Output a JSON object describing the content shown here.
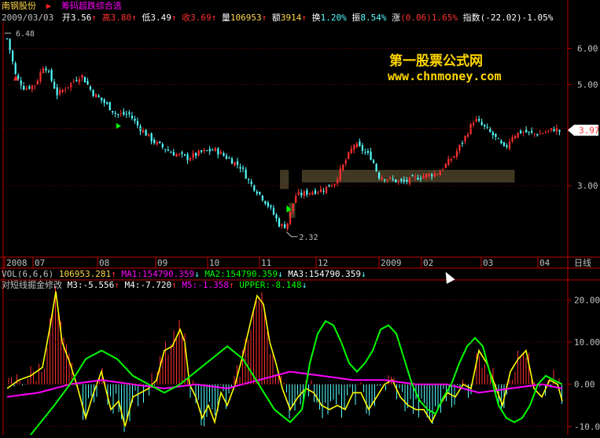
{
  "stock": {
    "name": "南钢股份",
    "flag": "▶",
    "formula": "筹码超跌综合选"
  },
  "quote": {
    "date": "2009/03/03",
    "open_label": "开",
    "open": "3.56",
    "high_label": "高",
    "high": "3.80",
    "low_label": "低",
    "low": "3.49",
    "close_label": "收",
    "close": "3.69",
    "vol_label": "量",
    "vol": "106953",
    "amt_label": "额",
    "amt": "3914",
    "turn_label": "换",
    "turn": "1.20%",
    "amp_label": "振",
    "amp": "8.54%",
    "chg_label": "涨",
    "chg": "(0.06)",
    "chg_pct": "1.65%",
    "idx_label": "指数",
    "idx": "(-22.02)",
    "idx_pct": "-1.05%",
    "up_arrow": "↑"
  },
  "watermark": {
    "title": "第一股票公式网",
    "url": "www.chnmoney.com"
  },
  "main_labels": {
    "high_mark": "6.48",
    "low_mark": "2.32",
    "last_price": "3.97"
  },
  "time_axis": {
    "labels": [
      "2008",
      "07",
      "08",
      "09",
      "10",
      "11",
      "12",
      "2009",
      "02",
      "03",
      "04"
    ],
    "period": "日线"
  },
  "vol_line": {
    "name": "VOL(6,6,6)",
    "value": "106953.281",
    "ma1": "MA1:154790.359",
    "ma2": "MA2:154790.359",
    "ma3": "MA3:154790.359",
    "up": "↑",
    "down": "↓"
  },
  "ind_line": {
    "name": "对短线掘金修改",
    "m3": "M3:-5.556",
    "m4": "M4:-7.720",
    "m5": "M5:-1.358",
    "upper": "UPPER:-8.148"
  },
  "colors": {
    "up": "#ff3030",
    "down": "#54ffff",
    "grid": "#8b0000",
    "axis": "#c00000",
    "m3": "#ffff00",
    "m5": "#ff00ff",
    "upper": "#00ff00",
    "zone": "#b8a060"
  },
  "chart_data": [
    {
      "type": "candlestick",
      "title": "南钢股份",
      "yticks": [
        3.0,
        4.0,
        5.0,
        6.0
      ],
      "ylim": [
        2.1,
        6.8
      ],
      "y_scale": "log",
      "annotations": {
        "high": 6.48,
        "low": 2.32,
        "last": 3.97
      },
      "close_path": [
        [
          0,
          6.3
        ],
        [
          8,
          5.2
        ],
        [
          16,
          4.9
        ],
        [
          26,
          5.0
        ],
        [
          34,
          5.55
        ],
        [
          46,
          4.75
        ],
        [
          55,
          4.95
        ],
        [
          68,
          5.25
        ],
        [
          78,
          4.8
        ],
        [
          92,
          4.5
        ],
        [
          100,
          4.3
        ],
        [
          112,
          4.3
        ],
        [
          120,
          4.05
        ],
        [
          134,
          3.75
        ],
        [
          150,
          3.55
        ],
        [
          165,
          3.45
        ],
        [
          178,
          3.55
        ],
        [
          190,
          3.6
        ],
        [
          202,
          3.45
        ],
        [
          214,
          3.3
        ],
        [
          222,
          3.05
        ],
        [
          230,
          2.9
        ],
        [
          240,
          2.7
        ],
        [
          250,
          2.45
        ],
        [
          256,
          2.45
        ],
        [
          264,
          2.85
        ],
        [
          276,
          2.9
        ],
        [
          290,
          2.95
        ],
        [
          300,
          3.05
        ],
        [
          310,
          3.4
        ],
        [
          318,
          3.7
        ],
        [
          325,
          3.6
        ],
        [
          334,
          3.45
        ],
        [
          340,
          3.15
        ],
        [
          350,
          3.1
        ],
        [
          362,
          3.05
        ],
        [
          380,
          3.15
        ],
        [
          395,
          3.2
        ],
        [
          410,
          3.5
        ],
        [
          420,
          3.85
        ],
        [
          428,
          4.2
        ],
        [
          436,
          4.05
        ],
        [
          446,
          3.85
        ],
        [
          456,
          3.6
        ],
        [
          462,
          3.85
        ],
        [
          472,
          3.95
        ],
        [
          480,
          3.9
        ],
        [
          488,
          3.9
        ],
        [
          496,
          3.95
        ],
        [
          502,
          4.0
        ],
        [
          506,
          3.95
        ]
      ]
    },
    {
      "type": "histogram",
      "title": "VOL(6,6,6)",
      "values_note": "volume sub-panel",
      "series": [
        {
          "name": "VOL",
          "last": 106953.281
        },
        {
          "name": "MA1",
          "last": 154790.359
        }
      ]
    },
    {
      "type": "line",
      "title": "对短线掘金修改",
      "yticks": [
        -10.0,
        0.0,
        10.0,
        20.0
      ],
      "ylim": [
        -12,
        24
      ],
      "series": [
        {
          "name": "M3",
          "last": -5.556,
          "points": [
            [
              0,
              -1
            ],
            [
              15,
              1
            ],
            [
              30,
              2
            ],
            [
              45,
              4
            ],
            [
              55,
              14
            ],
            [
              62,
              22
            ],
            [
              70,
              10
            ],
            [
              80,
              5
            ],
            [
              90,
              -1
            ],
            [
              100,
              -8
            ],
            [
              110,
              -2
            ],
            [
              120,
              3
            ],
            [
              132,
              -6
            ],
            [
              142,
              -4
            ],
            [
              150,
              -10
            ],
            [
              160,
              -3
            ],
            [
              170,
              -2
            ],
            [
              180,
              -1
            ],
            [
              190,
              1
            ],
            [
              200,
              8
            ],
            [
              210,
              9
            ],
            [
              220,
              13
            ],
            [
              226,
              10
            ],
            [
              232,
              0
            ],
            [
              240,
              -3
            ],
            [
              248,
              -8
            ],
            [
              256,
              -5
            ],
            [
              264,
              -9
            ],
            [
              272,
              -2
            ],
            [
              280,
              -5
            ],
            [
              290,
              0
            ],
            [
              300,
              7
            ],
            [
              310,
              15
            ],
            [
              318,
              21
            ],
            [
              326,
              19
            ],
            [
              334,
              10
            ],
            [
              342,
              5
            ],
            [
              350,
              -1
            ],
            [
              360,
              -6
            ],
            [
              370,
              -3
            ],
            [
              380,
              -1
            ],
            [
              390,
              -2
            ],
            [
              400,
              -5
            ],
            [
              410,
              -6
            ],
            [
              420,
              -5
            ],
            [
              430,
              -6
            ],
            [
              440,
              -2
            ],
            [
              450,
              -2
            ],
            [
              460,
              -6
            ],
            [
              470,
              -3
            ],
            [
              480,
              0
            ],
            [
              490,
              1
            ],
            [
              500,
              -3
            ],
            [
              510,
              -5
            ],
            [
              520,
              -6
            ],
            [
              530,
              -6
            ],
            [
              540,
              -9
            ],
            [
              550,
              -5
            ],
            [
              560,
              -2
            ],
            [
              570,
              -3
            ],
            [
              580,
              0
            ],
            [
              590,
              -1
            ],
            [
              600,
              8
            ],
            [
              610,
              5
            ],
            [
              620,
              0
            ],
            [
              630,
              -5
            ],
            [
              640,
              3
            ],
            [
              650,
              6
            ],
            [
              660,
              8
            ],
            [
              670,
              -1
            ],
            [
              680,
              -3
            ],
            [
              690,
              1
            ],
            [
              700,
              0
            ],
            [
              706,
              -4
            ]
          ]
        },
        {
          "name": "M5",
          "last": -1.358,
          "points": [
            [
              0,
              -3
            ],
            [
              40,
              -2
            ],
            [
              80,
              0
            ],
            [
              120,
              1
            ],
            [
              160,
              0
            ],
            [
              200,
              -1
            ],
            [
              240,
              0
            ],
            [
              280,
              -1
            ],
            [
              320,
              1
            ],
            [
              360,
              3
            ],
            [
              400,
              2
            ],
            [
              440,
              1
            ],
            [
              480,
              1
            ],
            [
              520,
              0
            ],
            [
              560,
              0
            ],
            [
              600,
              -2
            ],
            [
              640,
              -1
            ],
            [
              680,
              0
            ],
            [
              706,
              -1
            ]
          ]
        },
        {
          "name": "UPPER",
          "last": -8.148,
          "points": [
            [
              0,
              -15
            ],
            [
              30,
              -12
            ],
            [
              60,
              -5
            ],
            [
              80,
              0
            ],
            [
              100,
              6
            ],
            [
              120,
              8
            ],
            [
              140,
              6
            ],
            [
              160,
              2
            ],
            [
              180,
              0
            ],
            [
              200,
              -2
            ],
            [
              220,
              0
            ],
            [
              240,
              3
            ],
            [
              260,
              6
            ],
            [
              280,
              9
            ],
            [
              300,
              6
            ],
            [
              320,
              0
            ],
            [
              340,
              -6
            ],
            [
              360,
              -9
            ],
            [
              375,
              -6
            ],
            [
              385,
              5
            ],
            [
              395,
              12
            ],
            [
              405,
              15
            ],
            [
              415,
              14
            ],
            [
              425,
              10
            ],
            [
              435,
              5
            ],
            [
              445,
              3
            ],
            [
              455,
              5
            ],
            [
              465,
              8
            ],
            [
              475,
              13
            ],
            [
              485,
              14
            ],
            [
              495,
              12
            ],
            [
              505,
              6
            ],
            [
              515,
              0
            ],
            [
              525,
              -4
            ],
            [
              535,
              -6
            ],
            [
              545,
              -7
            ],
            [
              555,
              -3
            ],
            [
              565,
              0
            ],
            [
              575,
              5
            ],
            [
              585,
              9
            ],
            [
              595,
              11
            ],
            [
              605,
              9
            ],
            [
              615,
              2
            ],
            [
              625,
              -5
            ],
            [
              635,
              -8
            ],
            [
              645,
              -9
            ],
            [
              655,
              -8
            ],
            [
              665,
              -5
            ],
            [
              675,
              0
            ],
            [
              685,
              2
            ],
            [
              695,
              1
            ],
            [
              706,
              0
            ]
          ]
        }
      ]
    }
  ]
}
